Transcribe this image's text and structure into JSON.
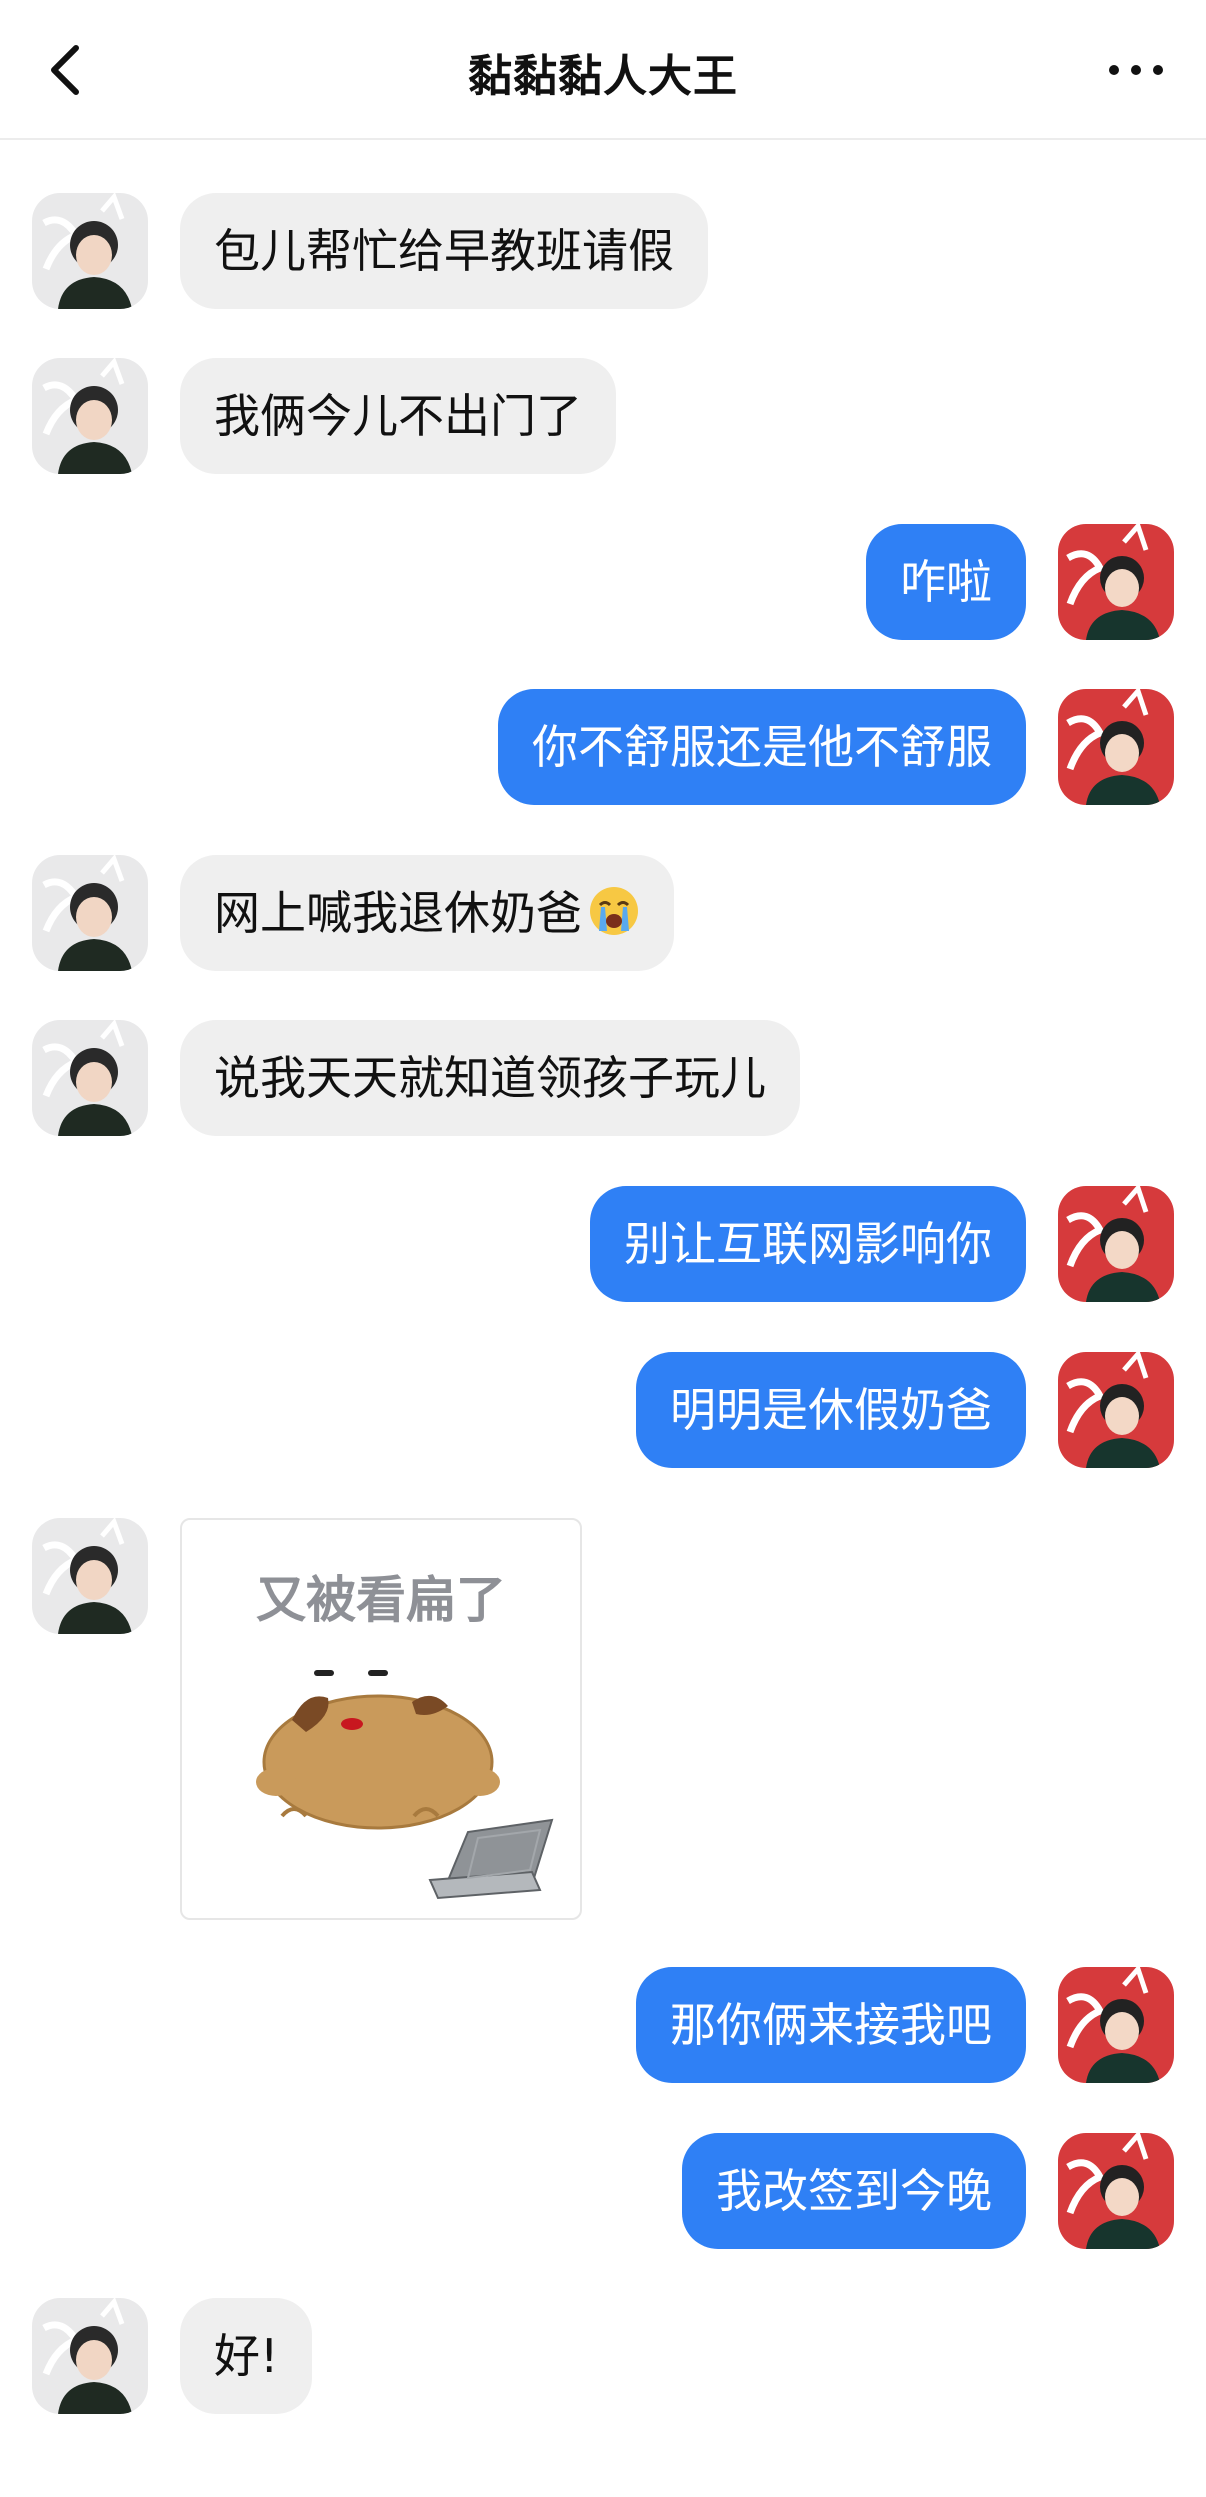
{
  "header": {
    "title": "黏黏黏人大王",
    "back_icon": "chevron-left-icon",
    "more_icon": "more-dots-icon"
  },
  "colors": {
    "outgoing_bubble": "#2f80f5",
    "incoming_bubble": "#efefef",
    "background": "#ffffff"
  },
  "messages": [
    {
      "side": "in",
      "type": "text",
      "text": "包儿帮忙给早教班请假"
    },
    {
      "side": "in",
      "type": "text",
      "text": "我俩今儿不出门了"
    },
    {
      "side": "out",
      "type": "text",
      "text": "咋啦"
    },
    {
      "side": "out",
      "type": "text",
      "text": "你不舒服还是他不舒服"
    },
    {
      "side": "in",
      "type": "text",
      "text": "网上喊我退休奶爸",
      "emoji": "loudly-crying-face-icon"
    },
    {
      "side": "in",
      "type": "text",
      "text": "说我天天就知道领孩子玩儿"
    },
    {
      "side": "out",
      "type": "text",
      "text": "别让互联网影响你"
    },
    {
      "side": "out",
      "type": "text",
      "text": "明明是休假奶爸"
    },
    {
      "side": "in",
      "type": "sticker",
      "text": "又被看扁了",
      "image": "potato-blob-with-laptop"
    },
    {
      "side": "out",
      "type": "text",
      "text": "那你俩来接我吧"
    },
    {
      "side": "out",
      "type": "text",
      "text": "我改签到今晚"
    },
    {
      "side": "in",
      "type": "text",
      "text": "好!"
    }
  ]
}
